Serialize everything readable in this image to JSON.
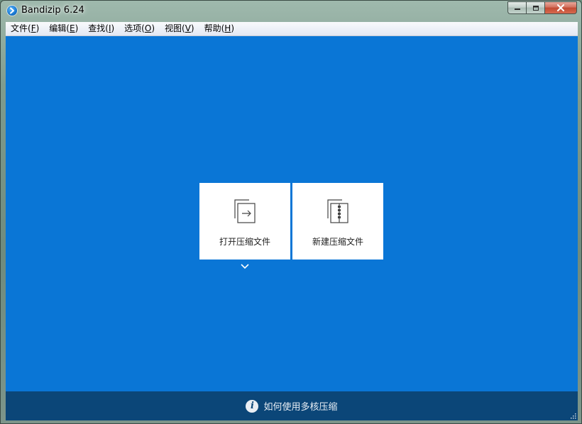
{
  "window": {
    "title": "Bandizip 6.24",
    "app_icon": "bandizip-logo-icon",
    "caption_buttons": [
      "minimize-icon",
      "maximize-icon",
      "close-icon"
    ]
  },
  "menu": {
    "items": [
      {
        "text": "文件(",
        "key": "F",
        "end": ")"
      },
      {
        "text": "编辑(",
        "key": "E",
        "end": ")"
      },
      {
        "text": "查找(",
        "key": "I",
        "end": ")"
      },
      {
        "text": "选项(",
        "key": "O",
        "end": ")"
      },
      {
        "text": "视图(",
        "key": "V",
        "end": ")"
      },
      {
        "text": "帮助(",
        "key": "H",
        "end": ")"
      }
    ]
  },
  "tiles": {
    "open_label": "打开压缩文件",
    "new_label": "新建压缩文件",
    "open_icon": "open-archive-icon",
    "new_icon": "new-archive-icon",
    "dropdown_icon": "chevron-down-icon"
  },
  "footer": {
    "info_icon": "info-icon",
    "info_glyph": "i",
    "tip_text": "如何使用多核压缩"
  },
  "colors": {
    "content_bg": "#0a76d6",
    "footer_bg": "#0b4678",
    "tile_bg": "#ffffff"
  }
}
